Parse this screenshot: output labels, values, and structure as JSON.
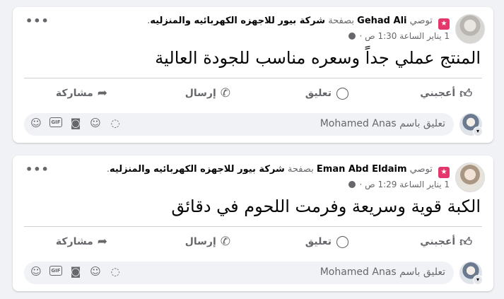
{
  "posts": [
    {
      "recommend_label": "توصي",
      "author": "Gehad Ali",
      "on_page_label": "بصفحة",
      "page_name": "شركة بيور للاجهزه الكهربائيه والمنزليه",
      "timestamp": "1 يناير الساعة 1:30 ص",
      "text": "المنتج عملي جداً وسعره مناسب للجودة العالية",
      "like_label": "أعجبني",
      "comment_label": "تعليق",
      "send_label": "إرسال",
      "share_label": "مشاركة",
      "comment_placeholder": "تعليق باسم Mohamed Anas"
    },
    {
      "recommend_label": "توصي",
      "author": "Eman Abd Eldaim",
      "on_page_label": "بصفحة",
      "page_name": "شركة بيور للاجهزه الكهربائيه والمنزليه",
      "timestamp": "1 يناير الساعة 1:29 ص",
      "text": "الكبة قوية وسريعة وفرمت اللحوم في دقائق",
      "like_label": "أعجبني",
      "comment_label": "تعليق",
      "send_label": "إرسال",
      "share_label": "مشاركة",
      "comment_placeholder": "تعليق باسم Mohamed Anas"
    }
  ],
  "icons": {
    "recommend": "star-badge-icon",
    "privacy": "globe-icon",
    "more": "more-options-icon",
    "like": "thumbs-up-icon",
    "comment": "speech-bubble-icon",
    "send": "messenger-icon",
    "share": "share-arrow-icon",
    "comment_tools": [
      "sticker-icon",
      "gif-icon",
      "camera-icon",
      "emoji-icon",
      "avatar-sticker-icon"
    ]
  },
  "colors": {
    "recommend_badge": "#e4366a",
    "secondary_text": "#65676b",
    "background": "#f0f2f5"
  }
}
